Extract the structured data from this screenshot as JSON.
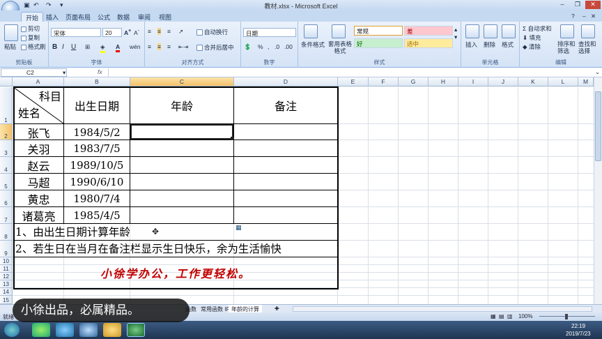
{
  "window": {
    "title": "教材.xlsx - Microsoft Excel"
  },
  "tabs": [
    "开始",
    "插入",
    "页面布局",
    "公式",
    "数据",
    "审阅",
    "视图"
  ],
  "ribbon": {
    "clipboard": {
      "paste": "粘贴",
      "cut": "剪切",
      "copy": "复制",
      "format_painter": "格式刷",
      "label": "剪贴板"
    },
    "font": {
      "name": "宋体",
      "size": "20",
      "bold": "B",
      "italic": "I",
      "underline": "U",
      "label": "字体"
    },
    "alignment": {
      "wrap": "自动换行",
      "merge": "合并后居中",
      "label": "对齐方式"
    },
    "number": {
      "format": "日期",
      "label": "数字"
    },
    "styles": {
      "conditional": "条件格式",
      "table": "套用表格格式",
      "normal": "常规",
      "bad": "差",
      "good": "好",
      "neutral": "适中",
      "label": "样式"
    },
    "cells": {
      "insert": "插入",
      "delete": "删除",
      "format": "格式",
      "label": "单元格"
    },
    "editing": {
      "autosum": "自动求和",
      "fill": "填充",
      "clear": "清除",
      "sort": "排序和筛选",
      "find": "查找和选择",
      "label": "编辑"
    }
  },
  "formula_bar": {
    "name_box": "C2",
    "fx": "fx",
    "content": ""
  },
  "columns": [
    "A",
    "B",
    "C",
    "D",
    "E",
    "F",
    "G",
    "H",
    "I",
    "J",
    "K",
    "L",
    "M"
  ],
  "rows": [
    "1",
    "2",
    "3",
    "4",
    "5",
    "6",
    "7",
    "8",
    "9",
    "10",
    "11",
    "12",
    "13",
    "14",
    "15"
  ],
  "table": {
    "header": {
      "subject": "科目",
      "name": "姓名",
      "birth": "出生日期",
      "age": "年龄",
      "note": "备注"
    },
    "records": [
      {
        "name": "张飞",
        "birth": "1984/5/2"
      },
      {
        "name": "关羽",
        "birth": "1983/7/5"
      },
      {
        "name": "赵云",
        "birth": "1989/10/5"
      },
      {
        "name": "马超",
        "birth": "1990/6/10"
      },
      {
        "name": "黄忠",
        "birth": "1980/7/4"
      },
      {
        "name": "诸葛亮",
        "birth": "1985/4/5"
      }
    ],
    "task1": "1、由出生日期计算年龄",
    "task2": "2、若生日在当月在备注栏显示生日快乐，余为生活愉快",
    "slogan": "小徐学办公，工作更轻松。"
  },
  "sheets": [
    "函数",
    "常用函数 IF",
    "年龄的计算"
  ],
  "status": {
    "ready": "就绪",
    "zoom": "100%"
  },
  "taskbar": {
    "time": "22:19",
    "date": "2019/7/23"
  },
  "caption": "小徐出品，必属精品。",
  "colors": {
    "slogan": "#c00000",
    "accent": "#f4c06a",
    "ribbon": "#d4e3f6"
  }
}
